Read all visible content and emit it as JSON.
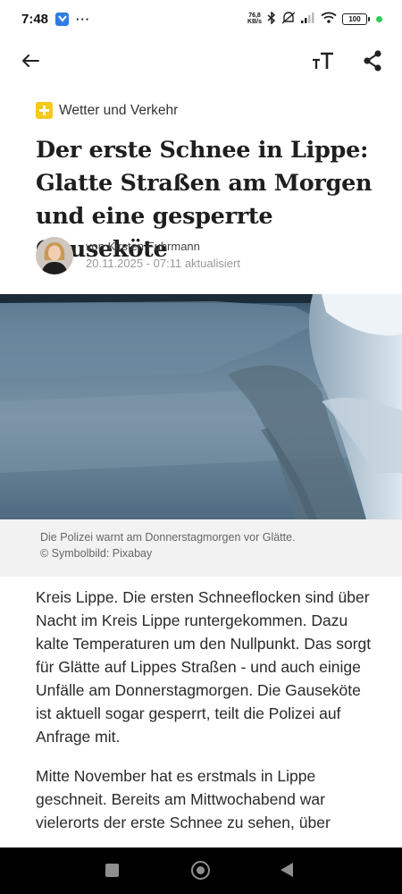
{
  "status_bar": {
    "time": "7:48",
    "net_speed_value": "76,8",
    "net_speed_unit": "KB/s",
    "battery": "100"
  },
  "header": {
    "back_icon": "arrow-left-icon",
    "text_size_icon": "text-size-icon",
    "share_icon": "share-icon"
  },
  "article": {
    "category": "Wetter und Verkehr",
    "title": "Der erste Schnee in Lippe: Glatte Straßen am Morgen und eine gesperrte Gauseköte",
    "author": "von Kirsten Fuhrmann",
    "date": "20.11.2025 - 07:11 aktualisiert",
    "caption": "Die Polizei warnt am Donnerstagmorgen vor Glätte.",
    "credit": "© Symbolbild: Pixabay",
    "paragraphs": [
      "Kreis Lippe. Die ersten Schneeflocken sind über Nacht im Kreis Lippe runtergekommen. Dazu kalte Temperaturen um den Nullpunkt. Das sorgt für Glätte auf Lippes Straßen - und auch einige Unfälle am Donnerstagmorgen. Die Gauseköte ist aktuell sogar gesperrt, teilt die Polizei auf Anfrage mit.",
      "Mitte November hat es erstmals in Lippe geschneit. Bereits am Mittwochabend war vielerorts der erste Schnee zu sehen, über"
    ]
  },
  "colors": {
    "accent_badge": "#f6c91b",
    "status_dot": "#2ecc55",
    "app_badge": "#2f7de1"
  }
}
